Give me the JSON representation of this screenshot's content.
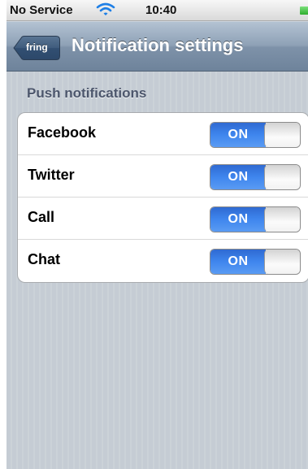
{
  "status_bar": {
    "carrier": "No Service",
    "time": "10:40",
    "wifi_icon": "wifi-icon",
    "battery_icon": "battery-icon",
    "battery_color": "#3cc43c"
  },
  "nav_bar": {
    "back_label": "fring",
    "title": "Notification settings"
  },
  "section": {
    "header": "Push notifications",
    "rows": [
      {
        "label": "Facebook",
        "toggle_label": "ON",
        "on": true
      },
      {
        "label": "Twitter",
        "toggle_label": "ON",
        "on": true
      },
      {
        "label": "Call",
        "toggle_label": "ON",
        "on": true
      },
      {
        "label": "Chat",
        "toggle_label": "ON",
        "on": true
      }
    ]
  },
  "colors": {
    "toggle_on": "#3f86ee",
    "nav_bar": "#8ea1b6",
    "background": "#c5ccd4",
    "section_header": "#4c566c"
  }
}
